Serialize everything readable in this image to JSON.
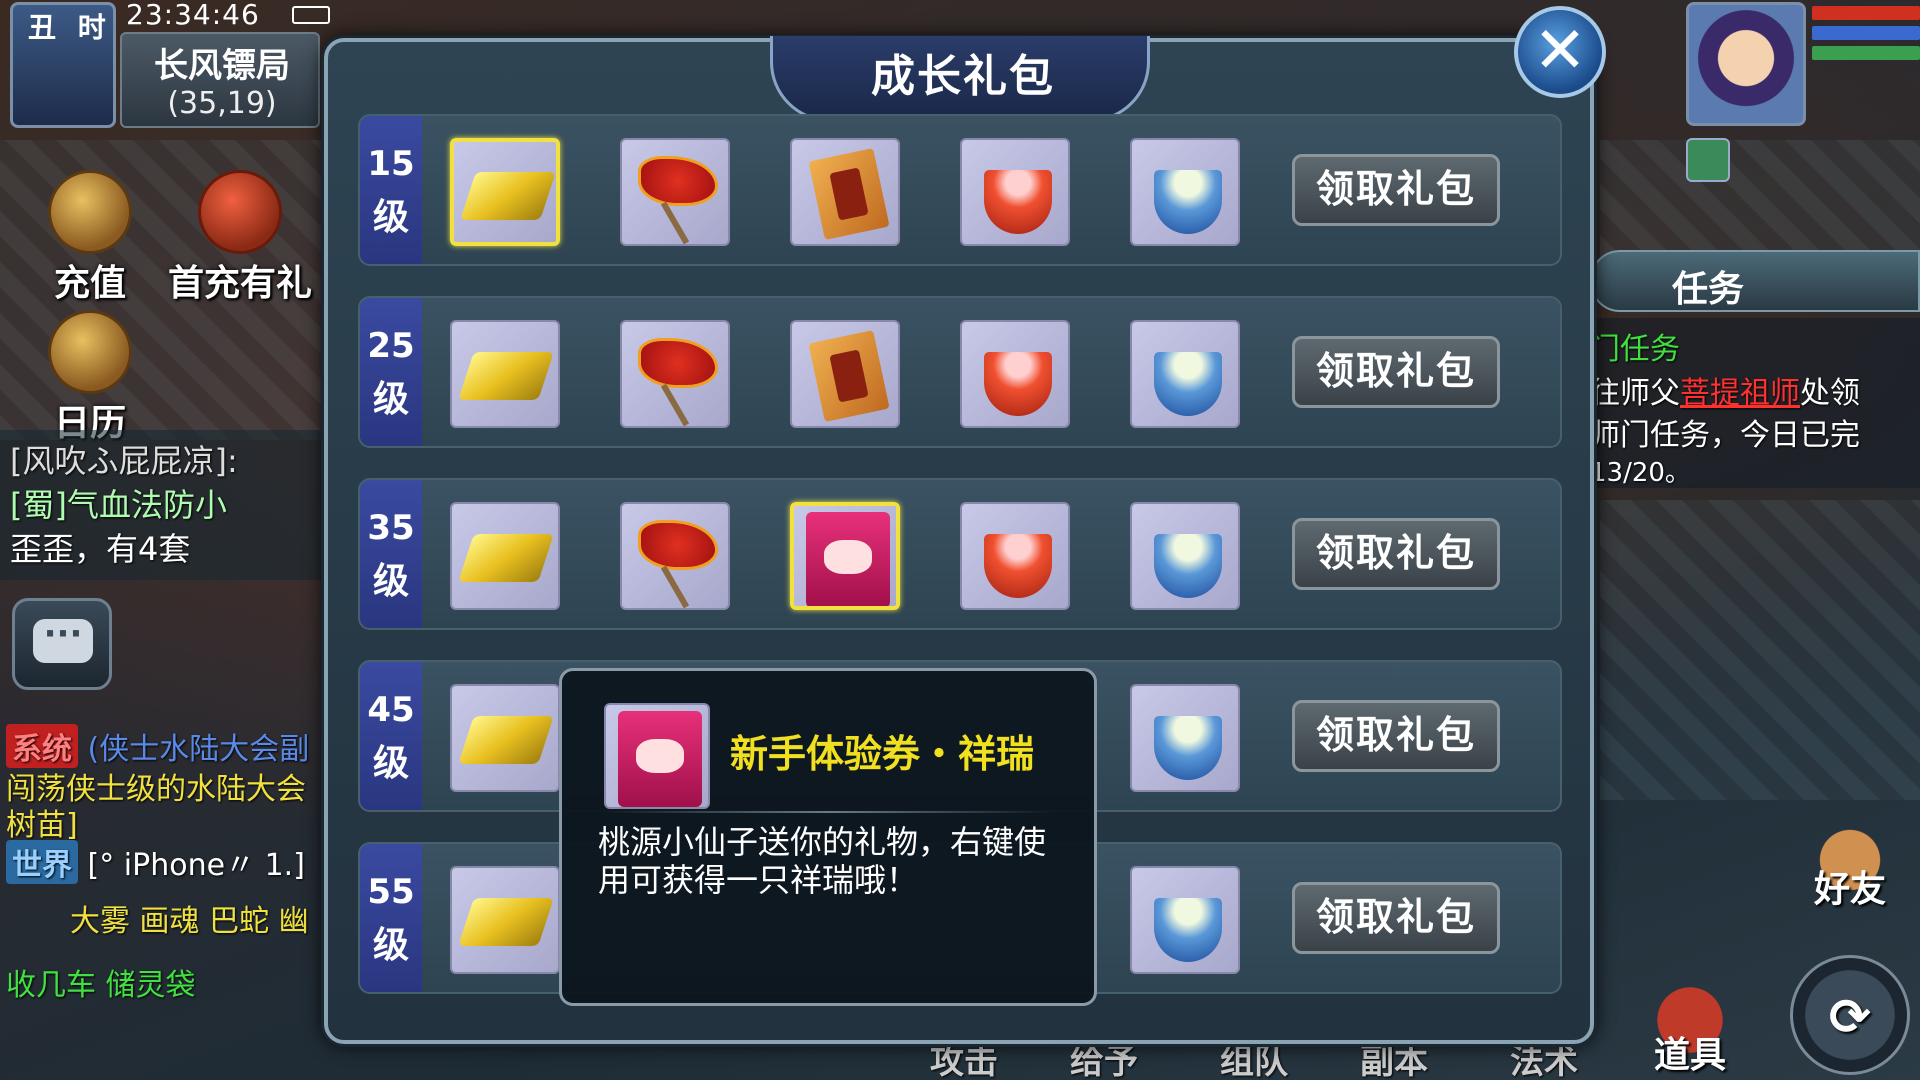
{
  "status": {
    "shichen": "丑 时",
    "time": "23:34:46"
  },
  "location": {
    "name": "长风镖局",
    "coords": "(35,19)"
  },
  "side_buttons": [
    {
      "label": "充值",
      "icon": "treasure-chest-icon"
    },
    {
      "label": "首充有礼",
      "icon": "gift-bag-icon"
    },
    {
      "label": "日历",
      "icon": "gong-icon"
    }
  ],
  "chat": {
    "line1": "[风吹ふ屁屁凉]:",
    "line2": "[蜀]气血法防小",
    "line3": "歪歪，有4套",
    "bubble": "···"
  },
  "bottom_chat": {
    "sys_tag": "系统",
    "sys_text": "(侠士水陆大会副",
    "line2": "闯荡侠士级的水陆大会",
    "line3": "树苗]",
    "world_tag": "世界",
    "world_text": "[° iPhone〃 1.]",
    "line5": "大雾  画魂  巴蛇  幽",
    "line6": "收几车  储灵袋"
  },
  "task": {
    "title": "任务",
    "line1": "门任务",
    "line2a": "往师父",
    "line2b": "菩提祖师",
    "line2c": "处领",
    "line3": "师门任务，今日已完",
    "line4": "13/20。"
  },
  "right_buttons": {
    "friends": "好友",
    "items": "道具"
  },
  "bottom_bar": [
    "攻击",
    "给予",
    "组队",
    "副本",
    "法术"
  ],
  "dialog": {
    "title": "成长礼包",
    "close": "✕",
    "rows": [
      {
        "level": "15",
        "unit": "级",
        "claim": "领取礼包"
      },
      {
        "level": "25",
        "unit": "级",
        "claim": "领取礼包"
      },
      {
        "level": "35",
        "unit": "级",
        "claim": "领取礼包"
      },
      {
        "level": "45",
        "unit": "级",
        "claim": "领取礼包"
      },
      {
        "level": "55",
        "unit": "级",
        "claim": "领取礼包"
      }
    ],
    "item_icons": [
      "gold-ingot-icon",
      "red-banner-icon",
      "scroll-icon",
      "red-bowl-icon",
      "blue-bowl-icon",
      "auspicious-card-icon"
    ]
  },
  "tooltip": {
    "title": "新手体验券・祥瑞",
    "desc": "桃源小仙子送你的礼物，右键使用可获得一只祥瑞哦！"
  },
  "colors": {
    "accent_yellow": "#f0e020",
    "highlight_red": "#ff3030",
    "task_green": "#40e040"
  }
}
